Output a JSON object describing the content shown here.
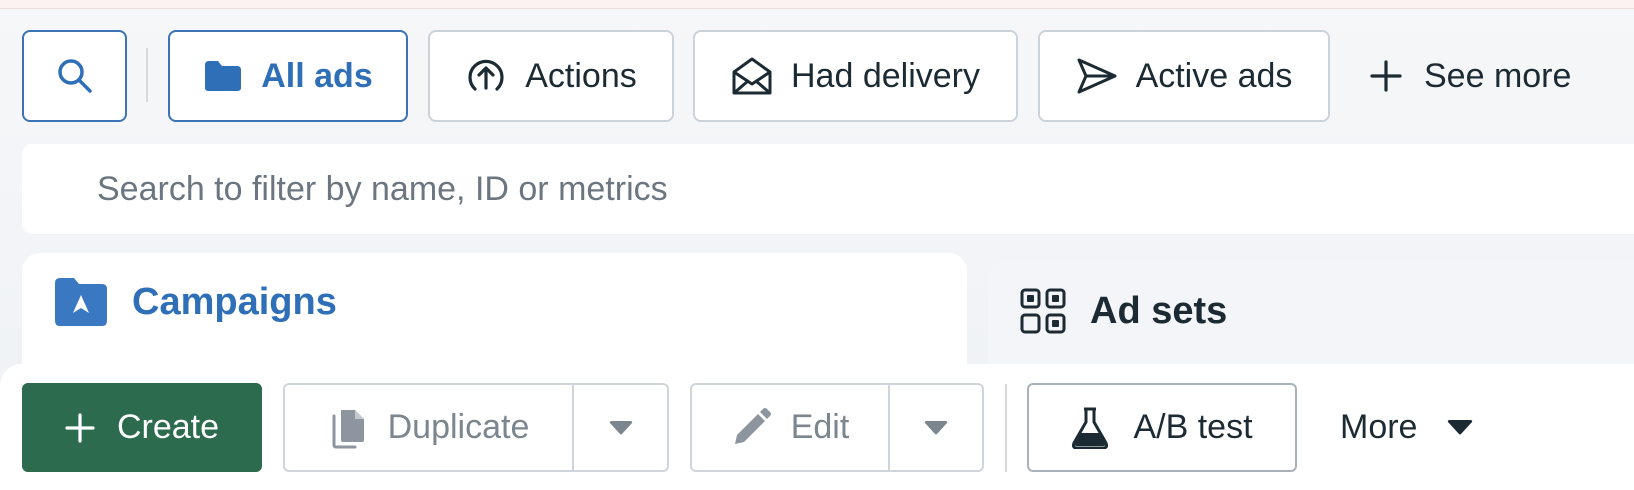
{
  "filters": {
    "search_icon": "search-icon",
    "chips": [
      {
        "label": "All ads",
        "icon": "folder-icon",
        "active": true
      },
      {
        "label": "Actions",
        "icon": "upload-circle-icon",
        "active": false
      },
      {
        "label": "Had delivery",
        "icon": "envelope-open-icon",
        "active": false
      },
      {
        "label": "Active ads",
        "icon": "send-icon",
        "active": false
      }
    ],
    "see_more": "See more"
  },
  "search": {
    "placeholder": "Search to filter by name, ID or metrics",
    "value": ""
  },
  "panels": {
    "campaigns": {
      "title": "Campaigns",
      "icon": "campaign-folder-icon"
    },
    "ad_sets": {
      "title": "Ad sets",
      "icon": "grid-icon"
    }
  },
  "toolbar": {
    "create": "Create",
    "duplicate": "Duplicate",
    "edit": "Edit",
    "ab_test": "A/B test",
    "more": "More"
  },
  "colors": {
    "accent_blue": "#2f6fb8",
    "create_green": "#2c6b4d",
    "text": "#1c2b33",
    "disabled_text": "#7c868f"
  }
}
